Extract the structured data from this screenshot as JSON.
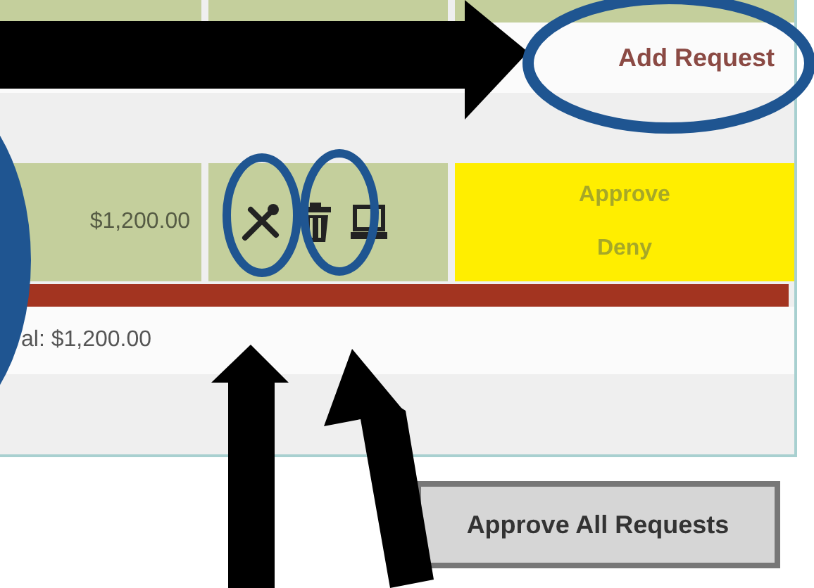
{
  "add_link": "Add Request",
  "request_row": {
    "amount": "$1,200.00",
    "actions": [
      "Approve",
      "Deny"
    ]
  },
  "total": "al: $1,200.00",
  "approve_all_button": "Approve All Requests"
}
